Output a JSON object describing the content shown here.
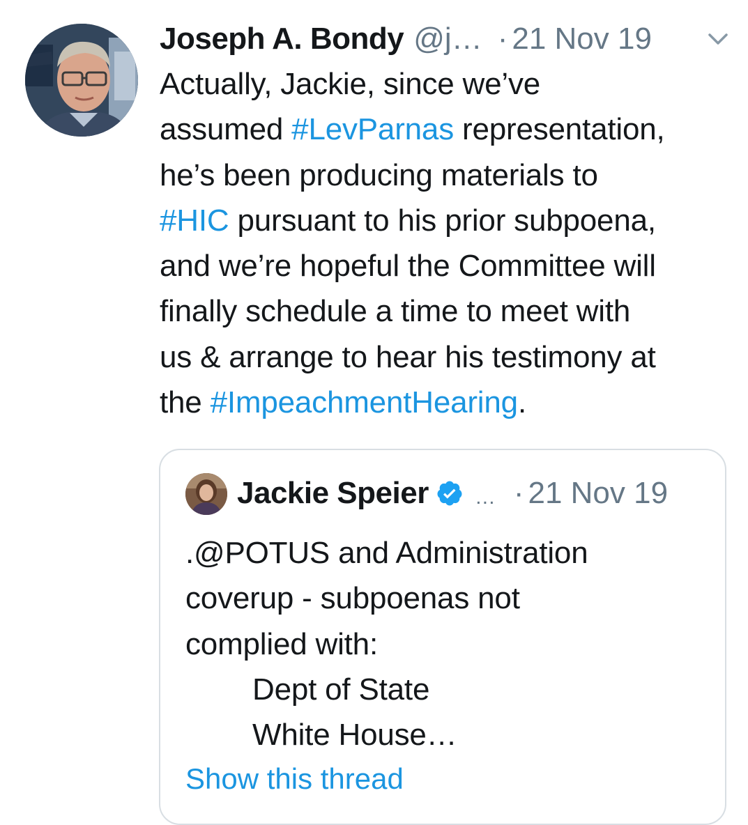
{
  "tweet": {
    "author_name": "Joseph A. Bondy",
    "author_handle": "@j…",
    "separator": "·",
    "date": "21 Nov 19",
    "menu_icon": "chevron-down-icon",
    "avatar_icon": "user-avatar",
    "body": {
      "line1": "Actually, Jackie, since we’ve",
      "line2_pre": "assumed ",
      "line2_tag": "#LevParnas",
      "line2_post": " representation,",
      "line3": "he’s been producing materials to",
      "line4_tag": "#HIC",
      "line4_post": " pursuant to his prior subpoena,",
      "line5": "and we’re hopeful the Committee will",
      "line6": "finally schedule a time to meet with",
      "line7": "us & arrange to hear his testimony at",
      "line8_pre": "the ",
      "line8_tag": "#ImpeachmentHearing",
      "line8_post": "."
    }
  },
  "quoted_tweet": {
    "author_name": "Jackie Speier",
    "verified_icon": "verified-badge-icon",
    "ellipsis": "…",
    "separator": "·",
    "date": "21 Nov 19",
    "body": {
      "line1": ".@POTUS and Administration",
      "line2": "coverup - subpoenas not",
      "line3": "complied with:",
      "line4": "Dept of State",
      "line5": "White House…"
    },
    "show_thread": "Show this thread"
  },
  "colors": {
    "text": "#14171a",
    "muted": "#657786",
    "link": "#1b95e0",
    "verified": "#1da1f2",
    "border": "#d8dee3"
  }
}
